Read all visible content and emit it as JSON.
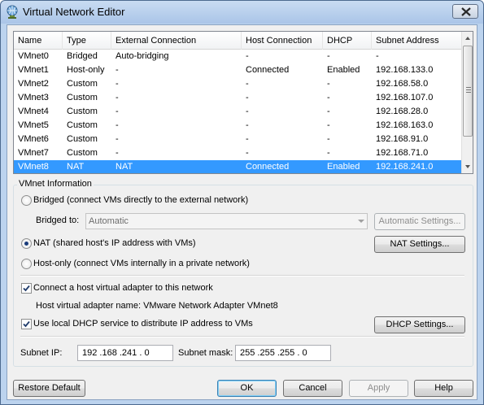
{
  "window": {
    "title": "Virtual Network Editor"
  },
  "list": {
    "columns": [
      "Name",
      "Type",
      "External Connection",
      "Host Connection",
      "DHCP",
      "Subnet Address"
    ],
    "rows": [
      [
        "VMnet0",
        "Bridged",
        "Auto-bridging",
        "-",
        "-",
        "-"
      ],
      [
        "VMnet1",
        "Host-only",
        "-",
        "Connected",
        "Enabled",
        "192.168.133.0"
      ],
      [
        "VMnet2",
        "Custom",
        "-",
        "-",
        "-",
        "192.168.58.0"
      ],
      [
        "VMnet3",
        "Custom",
        "-",
        "-",
        "-",
        "192.168.107.0"
      ],
      [
        "VMnet4",
        "Custom",
        "-",
        "-",
        "-",
        "192.168.28.0"
      ],
      [
        "VMnet5",
        "Custom",
        "-",
        "-",
        "-",
        "192.168.163.0"
      ],
      [
        "VMnet6",
        "Custom",
        "-",
        "-",
        "-",
        "192.168.91.0"
      ],
      [
        "VMnet7",
        "Custom",
        "-",
        "-",
        "-",
        "192.168.71.0"
      ],
      [
        "VMnet8",
        "NAT",
        "NAT",
        "Connected",
        "Enabled",
        "192.168.241.0"
      ]
    ],
    "selected_row": "VMnet8"
  },
  "info": {
    "group_title": "VMnet Information",
    "bridged_label": "Bridged (connect VMs directly to the external network)",
    "bridged_to_label": "Bridged to:",
    "bridged_to_value": "Automatic",
    "automatic_settings_button": "Automatic Settings...",
    "nat_label": "NAT (shared host's IP address with VMs)",
    "nat_settings_button": "NAT Settings...",
    "hostonly_label": "Host-only (connect VMs internally in a private network)",
    "selected_mode": "NAT",
    "connect_adapter_label": "Connect a host virtual adapter to this network",
    "connect_adapter_checked": true,
    "adapter_name_label": "Host virtual adapter name: VMware Network Adapter VMnet8",
    "dhcp_label": "Use local DHCP service to distribute IP address to VMs",
    "dhcp_checked": true,
    "dhcp_settings_button": "DHCP Settings...",
    "subnet_ip_label": "Subnet IP:",
    "subnet_ip_value": "192 .168 .241 . 0",
    "subnet_mask_label": "Subnet mask:",
    "subnet_mask_value": "255 .255 .255 . 0"
  },
  "footer": {
    "restore_default": "Restore Default",
    "ok": "OK",
    "cancel": "Cancel",
    "apply": "Apply",
    "help": "Help"
  },
  "colors": {
    "selection": "#3399ff",
    "title_bar": "#bcd3ee"
  },
  "icons": {
    "app": "network-globe-icon",
    "close": "close-icon"
  }
}
